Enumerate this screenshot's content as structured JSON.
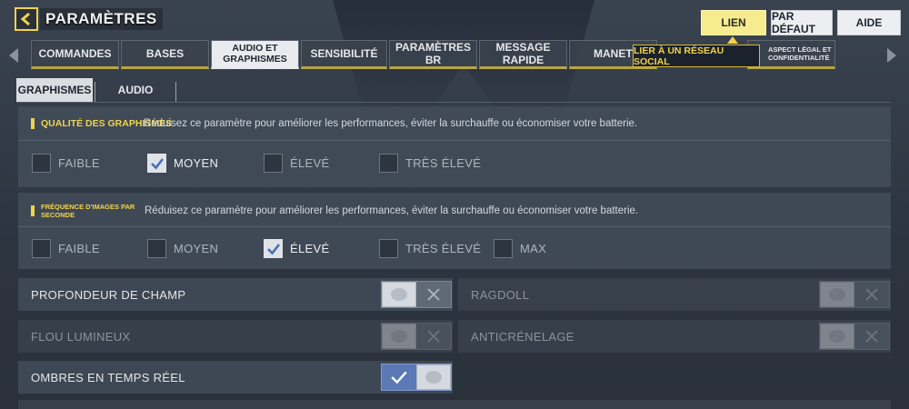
{
  "header": {
    "title": "PARAMÈTRES",
    "buttons": {
      "lien": "LIEN",
      "defaut": "PAR DÉFAUT",
      "aide": "AIDE"
    },
    "tooltip": "LIER À UN RÉSEAU SOCIAL"
  },
  "tabs": [
    {
      "label": "COMMANDES"
    },
    {
      "label": "BASES"
    },
    {
      "label": "AUDIO ET GRAPHISMES"
    },
    {
      "label": "SENSIBILITÉ"
    },
    {
      "label": "PARAMÈTRES BR"
    },
    {
      "label": "MESSAGE RAPIDE"
    },
    {
      "label": "MANETTE"
    },
    {
      "label": "ASPECT LÉGAL ET CONFIDENTIALITÉ"
    }
  ],
  "subtabs": [
    {
      "label": "GRAPHISMES"
    },
    {
      "label": "AUDIO"
    }
  ],
  "quality": {
    "title": "QUALITÉ DES GRAPHISMES",
    "description": "Réduisez ce paramètre pour améliorer les performances, éviter la surchauffe ou économiser votre batterie.",
    "options": [
      "FAIBLE",
      "MOYEN",
      "ÉLEVÉ",
      "TRÈS ÉLEVÉ"
    ],
    "selected": "MOYEN"
  },
  "framerate": {
    "title": "FRÉQUENCE D'IMAGES PAR SECONDE",
    "description": "Réduisez ce paramètre pour améliorer les performances, éviter la surchauffe ou économiser votre batterie.",
    "options": [
      "FAIBLE",
      "MOYEN",
      "ÉLEVÉ",
      "TRÈS ÉLEVÉ",
      "MAX"
    ],
    "selected": "ÉLEVÉ"
  },
  "toggles": [
    {
      "label": "PROFONDEUR DE CHAMP",
      "state": "off",
      "enabled": true
    },
    {
      "label": "RAGDOLL",
      "state": "off",
      "enabled": false
    },
    {
      "label": "FLOU LUMINEUX",
      "state": "off",
      "enabled": false
    },
    {
      "label": "ANTICRÉNELAGE",
      "state": "off",
      "enabled": false
    },
    {
      "label": "OMBRES EN TEMPS RÉEL",
      "state": "on",
      "enabled": true
    }
  ],
  "colors": {
    "accent": "#f1d34c",
    "toggle_on": "#5a79b5"
  }
}
